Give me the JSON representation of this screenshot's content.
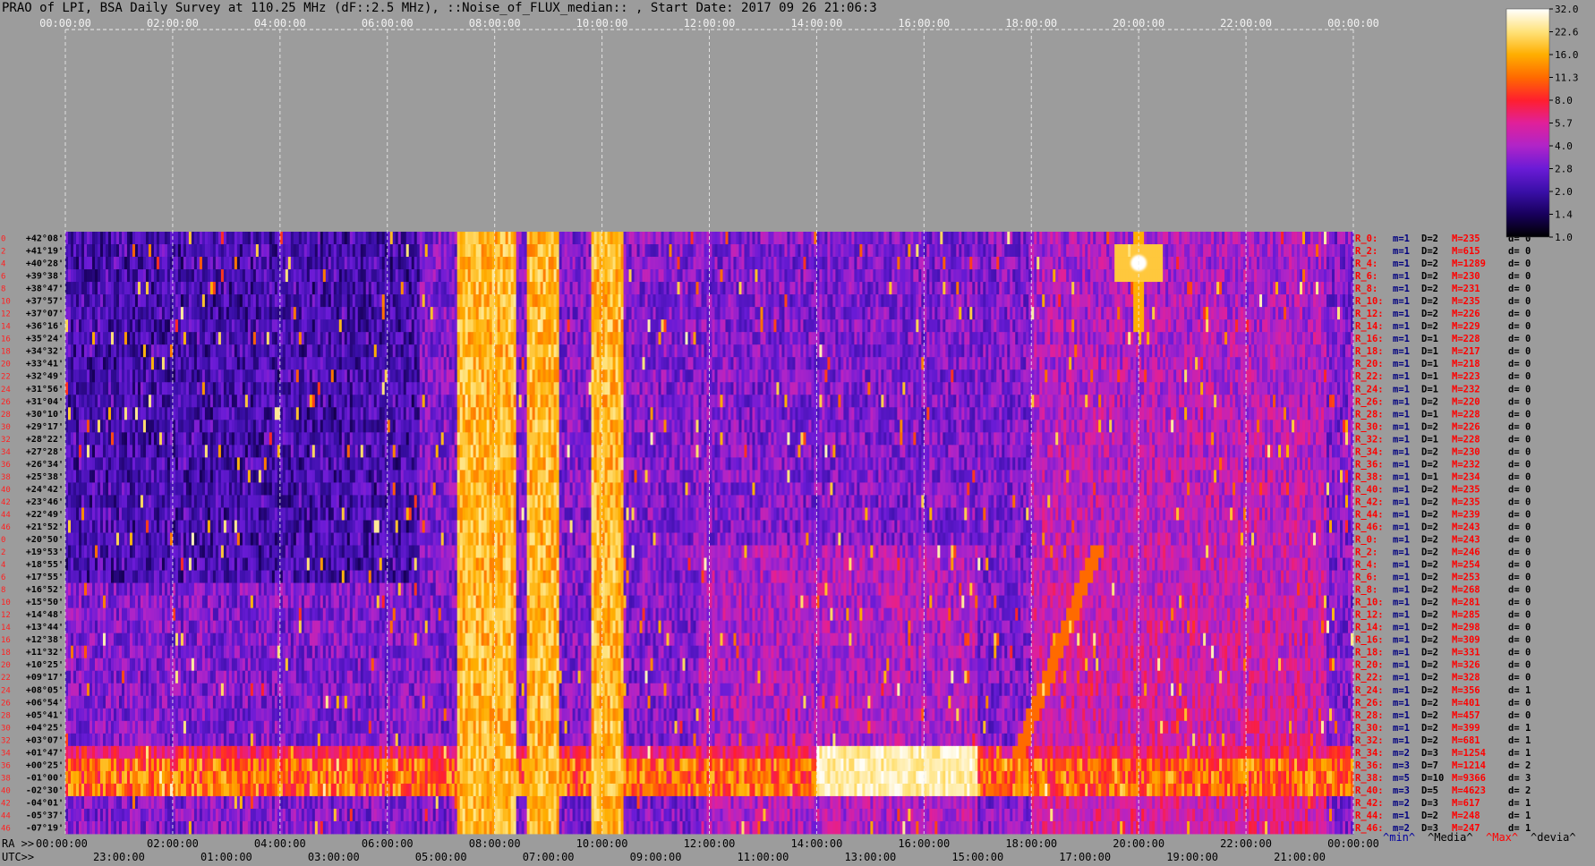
{
  "title": "PRAO of LPI, BSA Daily Survey at 110.25 MHz (dF::2.5 MHz), ::Noise_of_FLUX_median:: , Start Date: 2017 09 26 21:06:3",
  "axes": {
    "top_ticks": [
      "00:00:00",
      "02:00:00",
      "04:00:00",
      "06:00:00",
      "08:00:00",
      "10:00:00",
      "12:00:00",
      "14:00:00",
      "16:00:00",
      "18:00:00",
      "20:00:00",
      "22:00:00",
      "00:00:00"
    ],
    "bottom_ra_prefix": "RA >>",
    "bottom_ra_ticks": [
      "00:00:00",
      "02:00:00",
      "04:00:00",
      "06:00:00",
      "08:00:00",
      "10:00:00",
      "12:00:00",
      "14:00:00",
      "16:00:00",
      "18:00:00",
      "20:00:00",
      "22:00:00",
      "00:00:00"
    ],
    "bottom_utc_prefix": "UTC>>",
    "bottom_utc_ticks": [
      "23:00:00",
      "01:00:00",
      "03:00:00",
      "05:00:00",
      "07:00:00",
      "09:00:00",
      "11:00:00",
      "13:00:00",
      "15:00:00",
      "17:00:00",
      "19:00:00",
      "21:00:00"
    ]
  },
  "declinations": [
    "+42°08'",
    "+41°19'",
    "+40°28'",
    "+39°38'",
    "+38°47'",
    "+37°57'",
    "+37°07'",
    "+36°16'",
    "+35°24'",
    "+34°32'",
    "+33°41'",
    "+32°49'",
    "+31°56'",
    "+31°04'",
    "+30°10'",
    "+29°17'",
    "+28°22'",
    "+27°28'",
    "+26°34'",
    "+25°38'",
    "+24°42'",
    "+23°46'",
    "+22°49'",
    "+21°52'",
    "+20°50'",
    "+19°53'",
    "+18°55'",
    "+17°55'",
    "+16°52'",
    "+15°50'",
    "+14°48'",
    "+13°44'",
    "+12°38'",
    "+11°32'",
    "+10°25'",
    "+09°17'",
    "+08°05'",
    "+06°54'",
    "+05°41'",
    "+04°25'",
    "+03°07'",
    "+01°47'",
    "+00°25'",
    "-01°00'",
    "-02°30'",
    "-04°01'",
    "-05°37'",
    "-07°19'"
  ],
  "row_indices": [
    "0",
    "2",
    "4",
    "6",
    "8",
    "10",
    "12",
    "14",
    "16",
    "18",
    "20",
    "22",
    "24",
    "26",
    "28",
    "30",
    "32",
    "34",
    "36",
    "38",
    "40",
    "42",
    "44",
    "46",
    "0",
    "2",
    "4",
    "6",
    "8",
    "10",
    "12",
    "14",
    "16",
    "18",
    "20",
    "22",
    "24",
    "26",
    "28",
    "30",
    "32",
    "34",
    "36",
    "38",
    "40",
    "42",
    "44",
    "46"
  ],
  "beam_stats": [
    {
      "r": "R_0:",
      "m": "m=1",
      "d": "D=2",
      "M": "M=235",
      "dv": "d= 0"
    },
    {
      "r": "R_2:",
      "m": "m=1",
      "d": "D=2",
      "M": "M=615",
      "dv": "d= 0"
    },
    {
      "r": "R_4:",
      "m": "m=1",
      "d": "D=2",
      "M": "M=1289",
      "dv": "d= 0"
    },
    {
      "r": "R_6:",
      "m": "m=1",
      "d": "D=2",
      "M": "M=230",
      "dv": "d= 0"
    },
    {
      "r": "R_8:",
      "m": "m=1",
      "d": "D=2",
      "M": "M=231",
      "dv": "d= 0"
    },
    {
      "r": "R_10:",
      "m": "m=1",
      "d": "D=2",
      "M": "M=235",
      "dv": "d= 0"
    },
    {
      "r": "R_12:",
      "m": "m=1",
      "d": "D=2",
      "M": "M=226",
      "dv": "d= 0"
    },
    {
      "r": "R_14:",
      "m": "m=1",
      "d": "D=2",
      "M": "M=229",
      "dv": "d= 0"
    },
    {
      "r": "R_16:",
      "m": "m=1",
      "d": "D=1",
      "M": "M=228",
      "dv": "d= 0"
    },
    {
      "r": "R_18:",
      "m": "m=1",
      "d": "D=1",
      "M": "M=217",
      "dv": "d= 0"
    },
    {
      "r": "R_20:",
      "m": "m=1",
      "d": "D=1",
      "M": "M=218",
      "dv": "d= 0"
    },
    {
      "r": "R_22:",
      "m": "m=1",
      "d": "D=1",
      "M": "M=223",
      "dv": "d= 0"
    },
    {
      "r": "R_24:",
      "m": "m=1",
      "d": "D=1",
      "M": "M=232",
      "dv": "d= 0"
    },
    {
      "r": "R_26:",
      "m": "m=1",
      "d": "D=2",
      "M": "M=220",
      "dv": "d= 0"
    },
    {
      "r": "R_28:",
      "m": "m=1",
      "d": "D=1",
      "M": "M=228",
      "dv": "d= 0"
    },
    {
      "r": "R_30:",
      "m": "m=1",
      "d": "D=2",
      "M": "M=226",
      "dv": "d= 0"
    },
    {
      "r": "R_32:",
      "m": "m=1",
      "d": "D=1",
      "M": "M=228",
      "dv": "d= 0"
    },
    {
      "r": "R_34:",
      "m": "m=1",
      "d": "D=2",
      "M": "M=230",
      "dv": "d= 0"
    },
    {
      "r": "R_36:",
      "m": "m=1",
      "d": "D=2",
      "M": "M=232",
      "dv": "d= 0"
    },
    {
      "r": "R_38:",
      "m": "m=1",
      "d": "D=1",
      "M": "M=234",
      "dv": "d= 0"
    },
    {
      "r": "R_40:",
      "m": "m=1",
      "d": "D=2",
      "M": "M=235",
      "dv": "d= 0"
    },
    {
      "r": "R_42:",
      "m": "m=1",
      "d": "D=2",
      "M": "M=235",
      "dv": "d= 0"
    },
    {
      "r": "R_44:",
      "m": "m=1",
      "d": "D=2",
      "M": "M=239",
      "dv": "d= 0"
    },
    {
      "r": "R_46:",
      "m": "m=1",
      "d": "D=2",
      "M": "M=243",
      "dv": "d= 0"
    },
    {
      "r": "R_0:",
      "m": "m=1",
      "d": "D=2",
      "M": "M=243",
      "dv": "d= 0"
    },
    {
      "r": "R_2:",
      "m": "m=1",
      "d": "D=2",
      "M": "M=246",
      "dv": "d= 0"
    },
    {
      "r": "R_4:",
      "m": "m=1",
      "d": "D=2",
      "M": "M=254",
      "dv": "d= 0"
    },
    {
      "r": "R_6:",
      "m": "m=1",
      "d": "D=2",
      "M": "M=253",
      "dv": "d= 0"
    },
    {
      "r": "R_8:",
      "m": "m=1",
      "d": "D=2",
      "M": "M=268",
      "dv": "d= 0"
    },
    {
      "r": "R_10:",
      "m": "m=1",
      "d": "D=2",
      "M": "M=281",
      "dv": "d= 0"
    },
    {
      "r": "R_12:",
      "m": "m=1",
      "d": "D=2",
      "M": "M=285",
      "dv": "d= 0"
    },
    {
      "r": "R_14:",
      "m": "m=1",
      "d": "D=2",
      "M": "M=298",
      "dv": "d= 0"
    },
    {
      "r": "R_16:",
      "m": "m=1",
      "d": "D=2",
      "M": "M=309",
      "dv": "d= 0"
    },
    {
      "r": "R_18:",
      "m": "m=1",
      "d": "D=2",
      "M": "M=331",
      "dv": "d= 0"
    },
    {
      "r": "R_20:",
      "m": "m=1",
      "d": "D=2",
      "M": "M=326",
      "dv": "d= 0"
    },
    {
      "r": "R_22:",
      "m": "m=1",
      "d": "D=2",
      "M": "M=328",
      "dv": "d= 0"
    },
    {
      "r": "R_24:",
      "m": "m=1",
      "d": "D=2",
      "M": "M=356",
      "dv": "d= 1"
    },
    {
      "r": "R_26:",
      "m": "m=1",
      "d": "D=2",
      "M": "M=401",
      "dv": "d= 0"
    },
    {
      "r": "R_28:",
      "m": "m=1",
      "d": "D=2",
      "M": "M=457",
      "dv": "d= 0"
    },
    {
      "r": "R_30:",
      "m": "m=1",
      "d": "D=2",
      "M": "M=399",
      "dv": "d= 1"
    },
    {
      "r": "R_32:",
      "m": "m=1",
      "d": "D=2",
      "M": "M=681",
      "dv": "d= 1"
    },
    {
      "r": "R_34:",
      "m": "m=2",
      "d": "D=3",
      "M": "M=1254",
      "dv": "d= 1"
    },
    {
      "r": "R_36:",
      "m": "m=3",
      "d": "D=7",
      "M": "M=1214",
      "dv": "d= 2"
    },
    {
      "r": "R_38:",
      "m": "m=5",
      "d": "D=10",
      "M": "M=9366",
      "dv": "d= 3"
    },
    {
      "r": "R_40:",
      "m": "m=3",
      "d": "D=5",
      "M": "M=4623",
      "dv": "d= 2"
    },
    {
      "r": "R_42:",
      "m": "m=2",
      "d": "D=3",
      "M": "M=617",
      "dv": "d= 1"
    },
    {
      "r": "R_44:",
      "m": "m=1",
      "d": "D=2",
      "M": "M=248",
      "dv": "d= 1"
    },
    {
      "r": "R_46:",
      "m": "m=2",
      "d": "D=3",
      "M": "M=247",
      "dv": "d= 1"
    }
  ],
  "footer_legend": [
    {
      "label": "^min^",
      "color": "#0000a0"
    },
    {
      "label": "^Media^",
      "color": "#000000"
    },
    {
      "label": "^Max^",
      "color": "#ff0000"
    },
    {
      "label": "^devia^",
      "color": "#000000"
    }
  ],
  "colorbar": {
    "ticks": [
      "32.0",
      "22.6",
      "16.0",
      "11.3",
      "8.0",
      "5.7",
      "4.0",
      "2.8",
      "2.0",
      "1.4",
      "1.0"
    ],
    "colors": [
      "#000000",
      "#18005c",
      "#3a0fa8",
      "#6a1bd6",
      "#b024c8",
      "#e0209a",
      "#ff1f2e",
      "#ff6a00",
      "#ffae00",
      "#ffe27a",
      "#ffffff"
    ]
  },
  "chart_data": {
    "type": "heatmap",
    "title": "PRAO of LPI, BSA Daily Survey at 110.25 MHz (dF::2.5 MHz), ::Noise_of_FLUX_median:: , Start Date: 2017 09 26 21:06:3",
    "x_axis": "RA (hours), 00:00:00 to 24:00:00; UTC 21:06 to 21:06 next day",
    "y_axis": "Declination, +42°08' to -07°19' (48 beams)",
    "x_range_hours": [
      0,
      24
    ],
    "color_scale": "log",
    "value_range": [
      1.0,
      32.0
    ],
    "bright_vertical_bands_ra_hours": [
      [
        7.3,
        8.4
      ],
      [
        8.6,
        9.2
      ],
      [
        9.8,
        10.4
      ]
    ],
    "bright_block": {
      "ra_hours": [
        14.0,
        17.0
      ],
      "dec": [
        "+01°47'",
        "-02°30'"
      ]
    },
    "hot_horizontal_rows": [
      "+00°25'",
      "-01°00'",
      "-02°30'"
    ],
    "point_source": {
      "ra_hours": 20.0,
      "dec": "+40°28'"
    },
    "grid": true
  }
}
